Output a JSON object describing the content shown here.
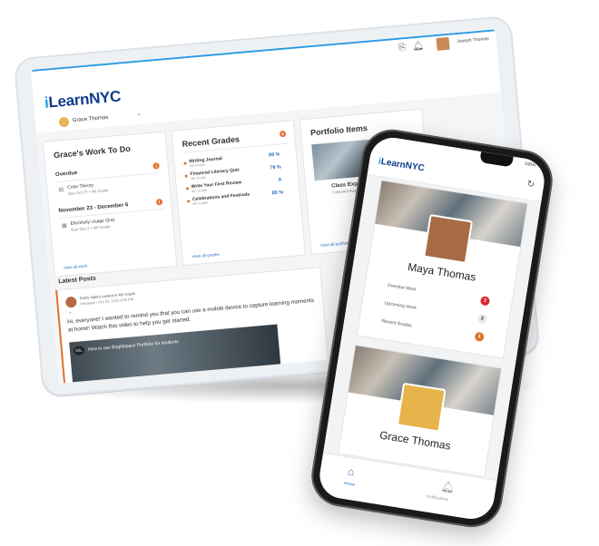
{
  "tablet": {
    "user_name": "Joseph Thomas",
    "logo_part1": "i",
    "logo_part2": "Learn",
    "logo_part3": "NYC",
    "student_selector": "Grace Thomas",
    "work_card": {
      "title": "Grace's Work To Do",
      "overdue_label": "Overdue",
      "overdue_count": "1",
      "overdue_item_title": "Color Theory",
      "overdue_item_meta": "Due Oct 27 • 4th Grade",
      "upcoming_label": "November 23 - December 6",
      "upcoming_count": "1",
      "upcoming_item_title": "Electricity Usage Quiz",
      "upcoming_item_meta": "Due Dec 2 • 4th Grade",
      "link": "View all work"
    },
    "grades_card": {
      "title": "Recent Grades",
      "count": "5",
      "items": [
        {
          "title": "Writing Journal",
          "sub": "4th Grade",
          "value": "89 %"
        },
        {
          "title": "Financial Literacy Quiz",
          "sub": "4th Grade",
          "value": "79 %"
        },
        {
          "title": "Write Your First Review",
          "sub": "4th Grade",
          "value": "A"
        },
        {
          "title": "Celebrations and Festivals",
          "sub": "4th Grade",
          "value": "80 %"
        }
      ],
      "link": "View all grades"
    },
    "portfolio_card": {
      "title": "Portfolio Items",
      "item_title": "Class Experiment",
      "item_meta": "Collected Aug 17, 2022",
      "link": "View all portfolio items"
    },
    "latest_posts_title": "Latest Posts",
    "post": {
      "author_line": "Emily Valero posted in 4th Grade",
      "meta_line": "Message • Oct 19, 2022 4:05 PM",
      "body": "Hi, everyone! I wanted to remind you that you can use a mobile device to capture learning moments at home! Watch this video to help you get started.",
      "video_badge": "D2L",
      "video_title": "How to use Brightspace Portfolio for students"
    }
  },
  "phone": {
    "status_battery": "100%",
    "logo_part1": "i",
    "logo_part2": "Learn",
    "logo_part3": "NYC",
    "student1": {
      "name": "Maya Thomas",
      "rows": [
        {
          "label": "Overdue Work",
          "value": "2"
        },
        {
          "label": "Upcoming Work",
          "value": "2"
        },
        {
          "label": "Recent Grades",
          "value": "1"
        }
      ]
    },
    "student2": {
      "name": "Grace Thomas"
    },
    "nav": {
      "home": "Home",
      "notifications": "Notifications"
    }
  },
  "colors": {
    "accent_blue": "#2b9be4",
    "brand_navy": "#0f3c8a",
    "orange": "#e2712c",
    "red": "#d9262b"
  }
}
